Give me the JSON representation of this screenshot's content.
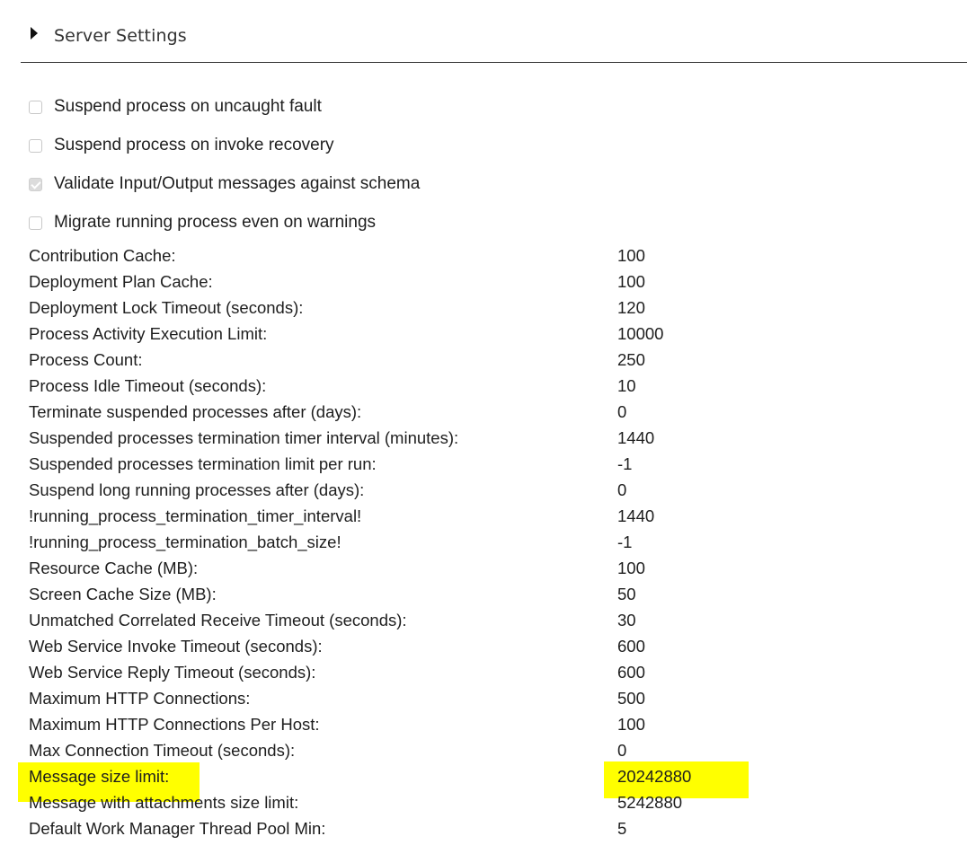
{
  "section": {
    "title": "Server Settings",
    "expand_icon": "triangle-right-icon"
  },
  "checkboxes": [
    {
      "label": "Suspend process on uncaught fault",
      "checked": false
    },
    {
      "label": "Suspend process on invoke recovery",
      "checked": false
    },
    {
      "label": "Validate Input/Output messages against schema",
      "checked": true
    },
    {
      "label": "Migrate running process even on warnings",
      "checked": false
    }
  ],
  "settings": [
    {
      "label": "Contribution Cache:",
      "value": "100"
    },
    {
      "label": "Deployment Plan Cache:",
      "value": "100"
    },
    {
      "label": "Deployment Lock Timeout (seconds):",
      "value": "120"
    },
    {
      "label": "Process Activity Execution Limit:",
      "value": "10000"
    },
    {
      "label": "Process Count:",
      "value": "250"
    },
    {
      "label": "Process Idle Timeout (seconds):",
      "value": "10"
    },
    {
      "label": "Terminate suspended processes after (days):",
      "value": "0"
    },
    {
      "label": "Suspended processes termination timer interval (minutes):",
      "value": "1440"
    },
    {
      "label": "Suspended processes termination limit per run:",
      "value": "-1"
    },
    {
      "label": "Suspend long running processes after (days):",
      "value": "0"
    },
    {
      "label": "!running_process_termination_timer_interval!",
      "value": "1440"
    },
    {
      "label": "!running_process_termination_batch_size!",
      "value": "-1"
    },
    {
      "label": "Resource Cache (MB):",
      "value": "100"
    },
    {
      "label": "Screen Cache Size (MB):",
      "value": "50"
    },
    {
      "label": "Unmatched Correlated Receive Timeout (seconds):",
      "value": "30"
    },
    {
      "label": "Web Service Invoke Timeout (seconds):",
      "value": "600"
    },
    {
      "label": "Web Service Reply Timeout (seconds):",
      "value": "600"
    },
    {
      "label": "Maximum HTTP Connections:",
      "value": "500"
    },
    {
      "label": "Maximum HTTP Connections Per Host:",
      "value": "100"
    },
    {
      "label": "Max Connection Timeout (seconds):",
      "value": "0"
    },
    {
      "label": "Message size limit:",
      "value": "20242880",
      "highlighted": true
    },
    {
      "label": "Message with attachments size limit:",
      "value": "5242880"
    },
    {
      "label": "Default Work Manager Thread Pool Min:",
      "value": "5"
    }
  ],
  "colors": {
    "highlight": "#ffff00",
    "text": "#1e1e1e",
    "divider": "#333333"
  }
}
